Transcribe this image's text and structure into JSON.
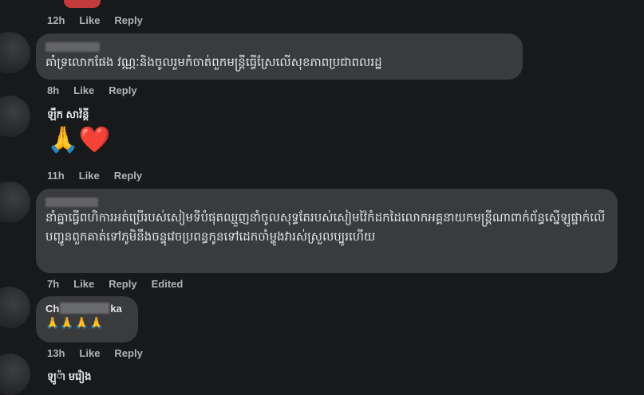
{
  "comments": [
    {
      "meta": {
        "time": "12h",
        "like": "Like",
        "reply": "Reply"
      }
    },
    {
      "text": "គាំទ្រលោកផែង វណ្ណៈនិងចូលរួមកំចាត់ពួកមន្ត្រីធ្វើស្រែលើសុខភាពប្រជាពលរដ្ឋ",
      "meta": {
        "time": "8h",
        "like": "Like",
        "reply": "Reply"
      }
    },
    {
      "author": "ឡឹក សាវ៉ន្តី",
      "text": "🙏❤️",
      "meta": {
        "time": "11h",
        "like": "Like",
        "reply": "Reply"
      }
    },
    {
      "text": "នាំគ្នាធ្វើពហិការអត់ប្រើរបស់សៀមទីបំផុតឈ្មួញនាំចូលសុទ្ធតែរបស់សៀមវ៉ៃកំដកដៃលោកអគ្គនាយកមន្ត្រីណាពាក់ព័ន្ធស្នើឡូផ្ទាក់លើបញ្ជូនពួកគាត់ទៅភូមិនឹងចន្ទុវេចប្រពន្ធកូនទៅដេកចាំម្ហូងវារស់ស្រួលប្បូរហើយ",
      "meta": {
        "time": "7h",
        "like": "Like",
        "reply": "Reply",
        "edited": "Edited"
      }
    },
    {
      "author_prefix": "Ch",
      "author_suffix": "ka",
      "text": "🙏🙏🙏🙏",
      "meta": {
        "time": "13h",
        "like": "Like",
        "reply": "Reply"
      }
    },
    {
      "author": "ឡូ៉ា មរ៉ៀង"
    }
  ]
}
